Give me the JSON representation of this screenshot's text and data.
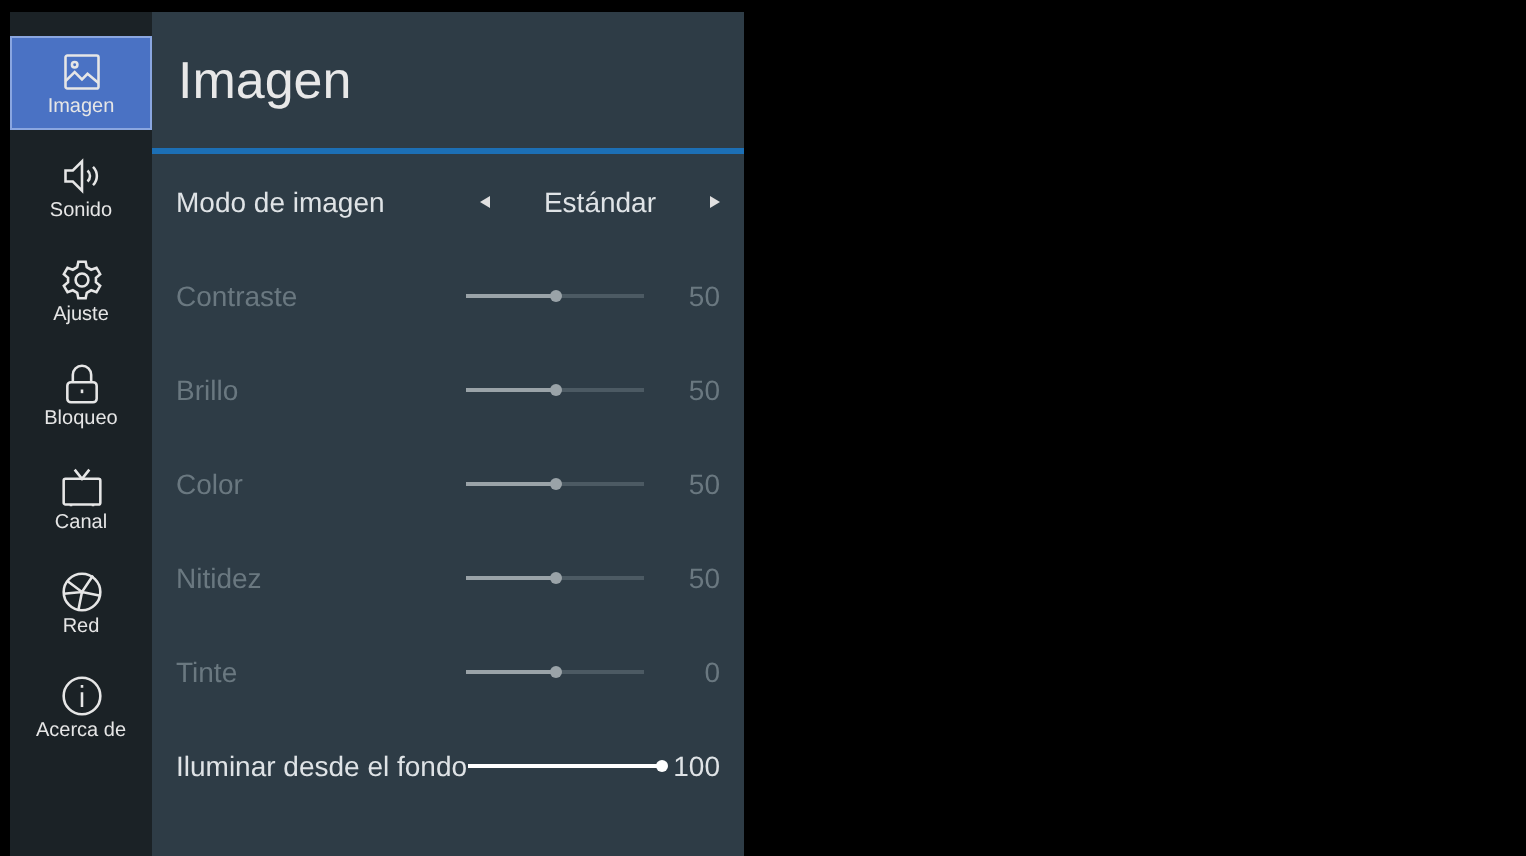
{
  "sidebar": {
    "items": [
      {
        "label": "Imagen",
        "selected": true
      },
      {
        "label": "Sonido",
        "selected": false
      },
      {
        "label": "Ajuste",
        "selected": false
      },
      {
        "label": "Bloqueo",
        "selected": false
      },
      {
        "label": "Canal",
        "selected": false
      },
      {
        "label": "Red",
        "selected": false
      },
      {
        "label": "Acerca de",
        "selected": false
      }
    ]
  },
  "panel": {
    "title": "Imagen",
    "rows": [
      {
        "kind": "select",
        "label": "Modo de imagen",
        "value": "Estándar",
        "disabled": false
      },
      {
        "kind": "slider",
        "label": "Contraste",
        "level": 0.5,
        "reading": "50",
        "disabled": true
      },
      {
        "kind": "slider",
        "label": "Brillo",
        "level": 0.5,
        "reading": "50",
        "disabled": true
      },
      {
        "kind": "slider",
        "label": "Color",
        "level": 0.5,
        "reading": "50",
        "disabled": true
      },
      {
        "kind": "slider",
        "label": "Nitidez",
        "level": 0.5,
        "reading": "50",
        "disabled": true
      },
      {
        "kind": "slider",
        "label": "Tinte",
        "level": 0.5,
        "reading": "0",
        "disabled": true
      },
      {
        "kind": "slider",
        "label": "Iluminar desde el fondo",
        "level": 1,
        "reading": "100",
        "disabled": false
      }
    ]
  }
}
